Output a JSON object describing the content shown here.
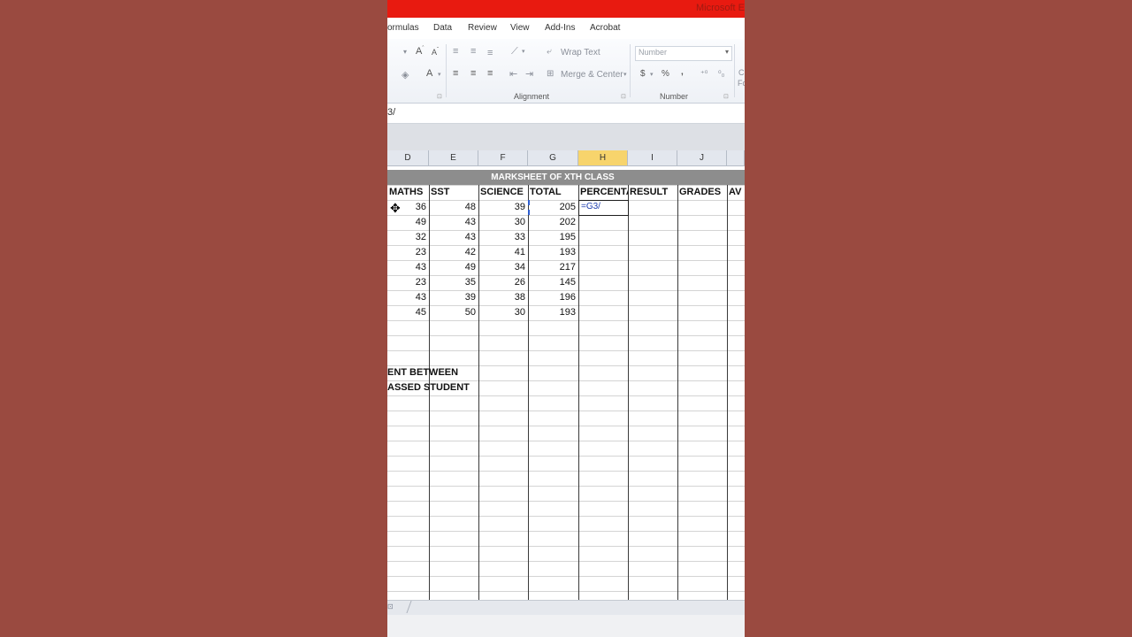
{
  "title_bar": {
    "text": "Microsoft E"
  },
  "menu": [
    "ormulas",
    "Data",
    "Review",
    "View",
    "Add-Ins",
    "Acrobat"
  ],
  "ribbon": {
    "wrap_text": "Wrap Text",
    "merge_center": "Merge & Center",
    "number_format": "Number",
    "currency": "$",
    "percent": "%",
    "comma": ",",
    "alignment_label": "Alignment",
    "number_label": "Number",
    "cond_letter": "C",
    "format_frag": "Fo"
  },
  "formula_bar": {
    "value": "3/"
  },
  "columns": [
    "D",
    "E",
    "F",
    "G",
    "H",
    "I",
    "J",
    ""
  ],
  "sheet": {
    "banner": "MARKSHEET OF XTH CLASS",
    "headers": [
      "MATHS",
      "SST",
      "SCIENCE",
      "TOTAL",
      "PERCENTA",
      "RESULT",
      "GRADES",
      "AV"
    ],
    "rows": [
      [
        "36",
        "48",
        "39",
        "205"
      ],
      [
        "49",
        "43",
        "30",
        "202"
      ],
      [
        "32",
        "43",
        "33",
        "195"
      ],
      [
        "23",
        "42",
        "41",
        "193"
      ],
      [
        "43",
        "49",
        "34",
        "217"
      ],
      [
        "23",
        "35",
        "26",
        "145"
      ],
      [
        "43",
        "39",
        "38",
        "196"
      ],
      [
        "45",
        "50",
        "30",
        "193"
      ]
    ],
    "active_cell": {
      "ref": "H3",
      "value": "=G3/"
    },
    "note_line_1": "ENT BETWEEN",
    "note_line_2": "ASSED STUDENT"
  }
}
